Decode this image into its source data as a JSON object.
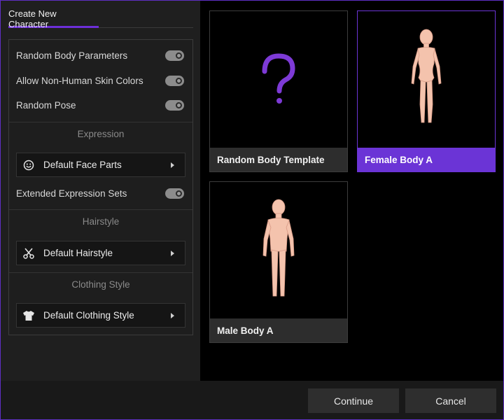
{
  "tabs": [
    {
      "label": "Create New Character",
      "active": true
    }
  ],
  "settings": {
    "toggles": [
      {
        "label": "Random Body Parameters",
        "on": true
      },
      {
        "label": "Allow Non-Human Skin Colors",
        "on": true
      },
      {
        "label": "Random Pose",
        "on": true
      }
    ],
    "expression": {
      "title": "Expression",
      "select": {
        "icon": "smiley-icon",
        "value": "Default Face Parts"
      },
      "toggle": {
        "label": "Extended Expression Sets",
        "on": true
      }
    },
    "hairstyle": {
      "title": "Hairstyle",
      "select": {
        "icon": "scissors-icon",
        "value": "Default Hairstyle"
      }
    },
    "clothing": {
      "title": "Clothing Style",
      "select": {
        "icon": "shirt-icon",
        "value": "Default Clothing Style"
      }
    }
  },
  "templates": [
    {
      "label": "Random Body Template",
      "icon": "question-mark-icon",
      "selected": false
    },
    {
      "label": "Female Body A",
      "icon": "female-body-icon",
      "selected": true
    },
    {
      "label": "Male Body A",
      "icon": "male-body-icon",
      "selected": false
    }
  ],
  "footer": {
    "continue_label": "Continue",
    "cancel_label": "Cancel"
  },
  "colors": {
    "accent": "#6b34d6",
    "skin": "#f4c3ad"
  }
}
